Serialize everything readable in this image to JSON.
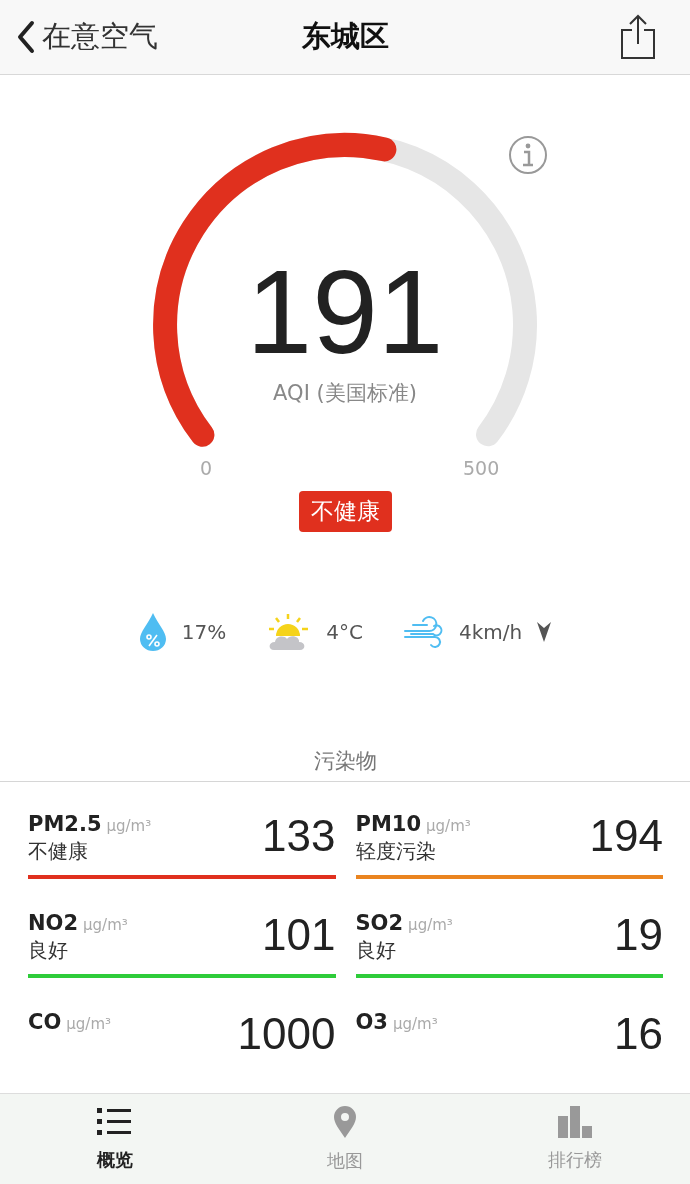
{
  "nav": {
    "back_label": "在意空气",
    "title": "东城区"
  },
  "aqi": {
    "value": "191",
    "label": "AQI (美国标准)",
    "min": "0",
    "max": "500",
    "category": "不健康",
    "color": "#e0301e"
  },
  "weather": [
    {
      "kind": "humidity",
      "text": "17%"
    },
    {
      "kind": "sky",
      "text": "4°C"
    },
    {
      "kind": "wind",
      "text": "4km/h"
    }
  ],
  "pollutants_heading": "污染物",
  "pollutants": [
    {
      "name": "PM2.5",
      "unit": "µg/m³",
      "status": "不健康",
      "value": "133",
      "color": "#e0301e"
    },
    {
      "name": "PM10",
      "unit": "µg/m³",
      "status": "轻度污染",
      "value": "194",
      "color": "#ea8420"
    },
    {
      "name": "NO2",
      "unit": "µg/m³",
      "status": "良好",
      "value": "101",
      "color": "#2ecc3a"
    },
    {
      "name": "SO2",
      "unit": "µg/m³",
      "status": "良好",
      "value": "19",
      "color": "#2ecc3a"
    },
    {
      "name": "CO",
      "unit": "µg/m³",
      "value": "1000"
    },
    {
      "name": "O3",
      "unit": "µg/m³",
      "value": "16"
    }
  ],
  "tabs": [
    {
      "kind": "list",
      "label": "概览",
      "selected": true
    },
    {
      "kind": "pin",
      "label": "地图",
      "selected": false
    },
    {
      "kind": "bars",
      "label": "排行榜",
      "selected": false
    }
  ]
}
